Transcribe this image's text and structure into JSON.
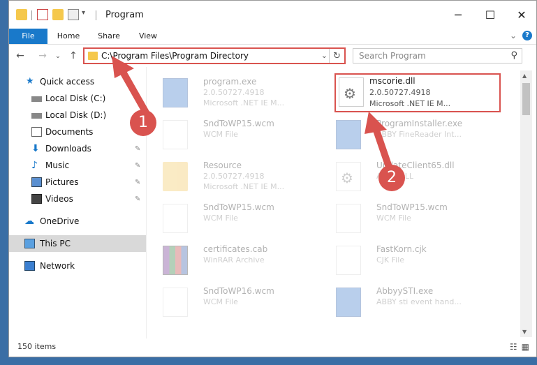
{
  "window": {
    "title": "Program",
    "controls": {
      "minimize": "─",
      "maximize": "☐",
      "close": "✕"
    }
  },
  "ribbon": {
    "tabs": [
      "File",
      "Home",
      "Share",
      "View"
    ],
    "expand": "⌄",
    "help": "?"
  },
  "nav": {
    "back": "←",
    "forward": "→",
    "recent": "⌄",
    "up": "↑",
    "address": "C:\\Program Files\\Program Directory",
    "address_dropdown": "⌄",
    "refresh": "↻",
    "search_placeholder": "Search Program",
    "search_icon": "⚲"
  },
  "sidebar": {
    "items": [
      {
        "label": "Quick access",
        "icon": "star-icon",
        "pinned": false
      },
      {
        "label": "Local Disk (C:)",
        "icon": "drive-icon",
        "pinned": true
      },
      {
        "label": "Local Disk (D:)",
        "icon": "drive-icon",
        "pinned": true
      },
      {
        "label": "Documents",
        "icon": "documents-icon",
        "pinned": true
      },
      {
        "label": "Downloads",
        "icon": "download-icon",
        "pinned": true
      },
      {
        "label": "Music",
        "icon": "music-icon",
        "pinned": true
      },
      {
        "label": "Pictures",
        "icon": "pictures-icon",
        "pinned": true
      },
      {
        "label": "Videos",
        "icon": "videos-icon",
        "pinned": true
      },
      {
        "label": "OneDrive",
        "icon": "cloud-icon",
        "pinned": false
      },
      {
        "label": "This PC",
        "icon": "computer-icon",
        "pinned": false
      },
      {
        "label": "Network",
        "icon": "network-icon",
        "pinned": false
      }
    ],
    "pin_glyph": "📌"
  },
  "files": [
    {
      "name": "program.exe",
      "line2": "2.0.50727.4918",
      "line3": "Microsoft .NET IE M...",
      "type": "exe"
    },
    {
      "name": "mscorie.dll",
      "line2": "2.0.50727.4918",
      "line3": "Microsoft .NET IE M...",
      "type": "dll"
    },
    {
      "name": "SndToWP15.wcm",
      "line2": "WCM File",
      "line3": "",
      "type": "page"
    },
    {
      "name": "ProgramInstaller.exe",
      "line2": "ABBY FineReader Int...",
      "line3": "",
      "type": "exe"
    },
    {
      "name": "Resource",
      "line2": "2.0.50727.4918",
      "line3": "Microsoft .NET IE M...",
      "type": "folder"
    },
    {
      "name": "UpdateClient65.dll",
      "line2": "ABBY DLL",
      "line3": "",
      "type": "dll"
    },
    {
      "name": "SndToWP15.wcm",
      "line2": "WCM File",
      "line3": "",
      "type": "page"
    },
    {
      "name": "SndToWP15.wcm",
      "line2": "WCM File",
      "line3": "",
      "type": "page"
    },
    {
      "name": "certificates.cab",
      "line2": "WinRAR Archive",
      "line3": "",
      "type": "rar"
    },
    {
      "name": "FastKorn.cjk",
      "line2": "CJK File",
      "line3": "",
      "type": "page"
    },
    {
      "name": "SndToWP16.wcm",
      "line2": "WCM File",
      "line3": "",
      "type": "page"
    },
    {
      "name": "AbbyySTI.exe",
      "line2": "ABBY sti event hand...",
      "line3": "",
      "type": "exe"
    }
  ],
  "status": {
    "count": "150 items",
    "details_view": "☷",
    "tiles_view": "▦"
  },
  "annotations": [
    "1",
    "2"
  ],
  "colors": {
    "accent": "#1979ca",
    "highlight": "#d9534f"
  }
}
